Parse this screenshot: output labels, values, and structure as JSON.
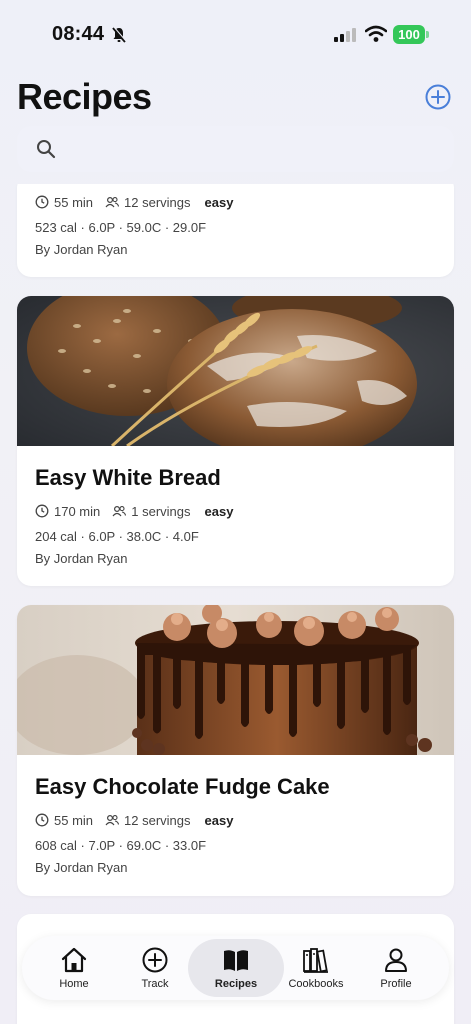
{
  "status_bar": {
    "time": "08:44",
    "battery": "100"
  },
  "header": {
    "title": "Recipes"
  },
  "search": {
    "placeholder": ""
  },
  "recipes": [
    {
      "title": "",
      "time": "55 min",
      "servings": "12 servings",
      "difficulty": "easy",
      "nutrition": "523 cal · 6.0P · 59.0C · 29.0F",
      "author": "By Jordan Ryan"
    },
    {
      "title": "Easy White Bread",
      "time": "170 min",
      "servings": "1 servings",
      "difficulty": "easy",
      "nutrition": "204 cal · 6.0P · 38.0C · 4.0F",
      "author": "By Jordan Ryan"
    },
    {
      "title": "Easy Chocolate Fudge Cake",
      "time": "55 min",
      "servings": "12 servings",
      "difficulty": "easy",
      "nutrition": "608 cal · 7.0P · 69.0C · 33.0F",
      "author": "By Jordan Ryan"
    }
  ],
  "tabs": [
    {
      "label": "Home",
      "icon": "home-icon"
    },
    {
      "label": "Track",
      "icon": "plus-circle-icon"
    },
    {
      "label": "Recipes",
      "icon": "book-open-icon"
    },
    {
      "label": "Cookbooks",
      "icon": "books-icon"
    },
    {
      "label": "Profile",
      "icon": "person-icon"
    }
  ],
  "colors": {
    "accent": "#4a7fd9",
    "battery": "#34c759",
    "card_bg": "#ffffff"
  }
}
